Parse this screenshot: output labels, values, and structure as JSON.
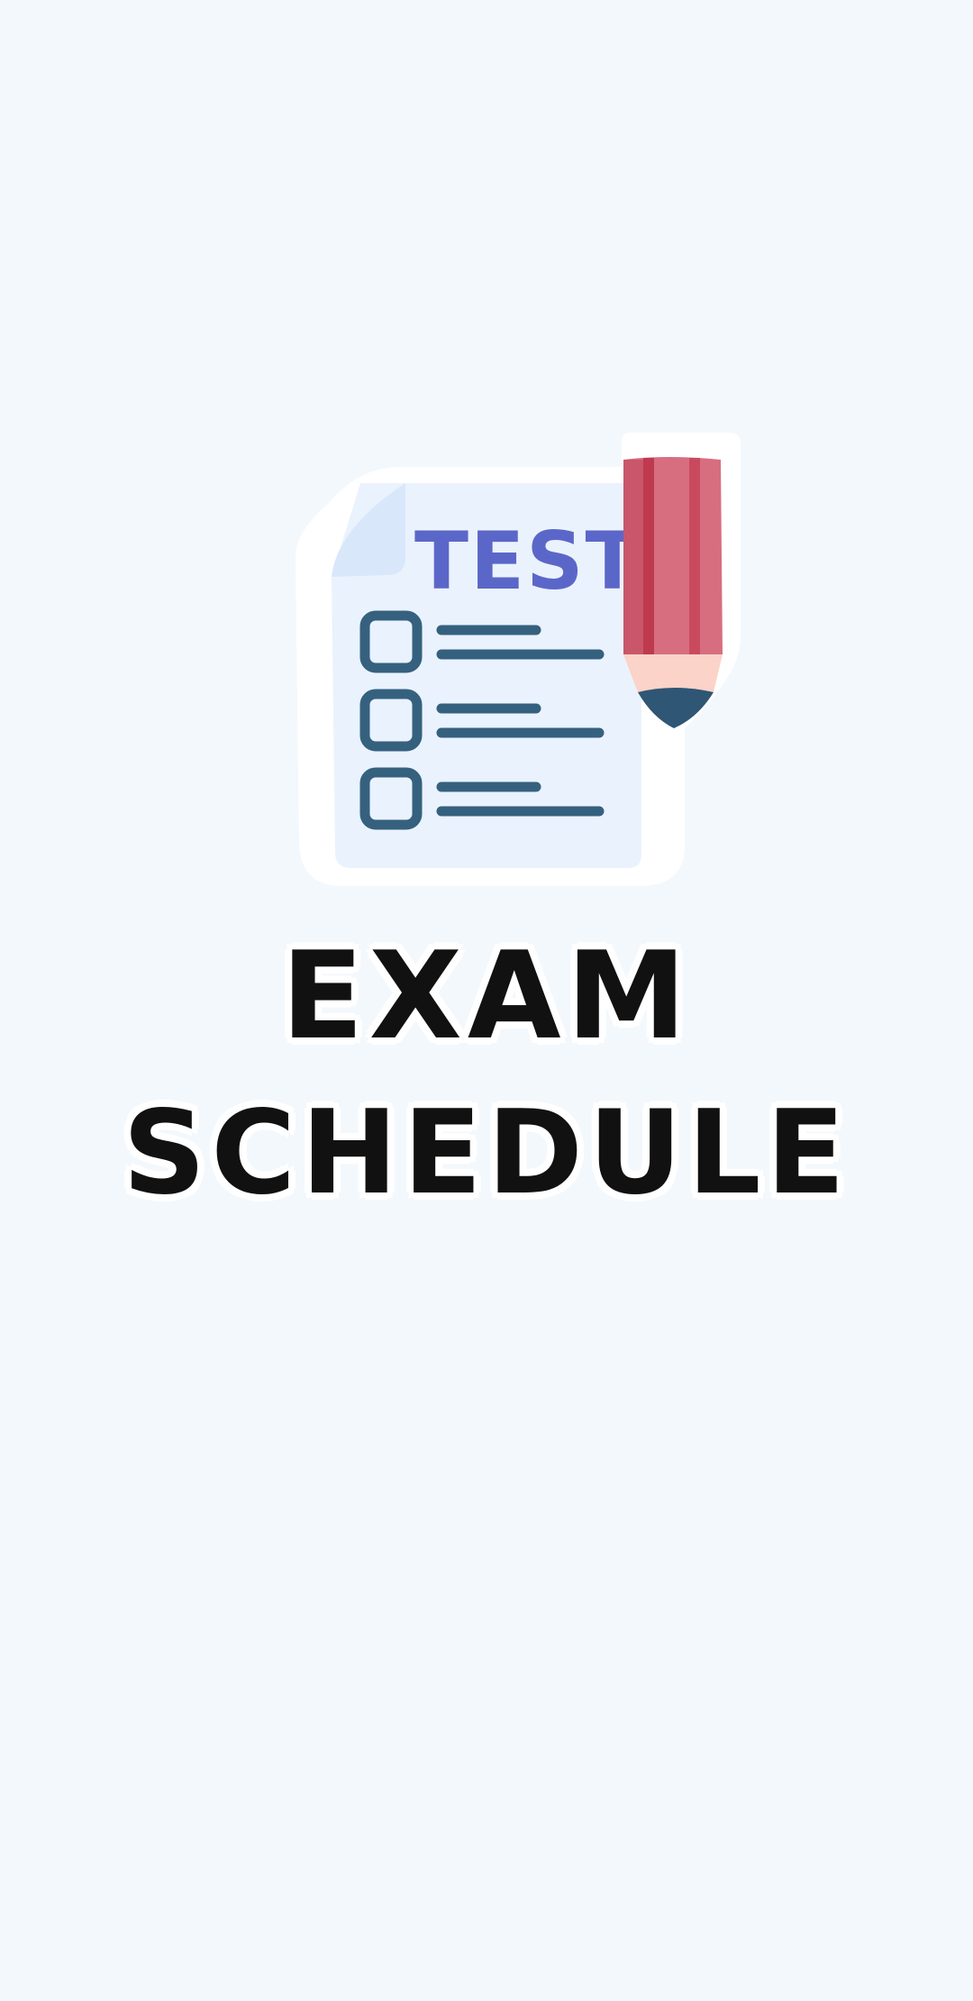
{
  "splash": {
    "logo_badge_text": "TEST",
    "title_line_1": "EXAM",
    "title_line_2": "SCHEDULE"
  },
  "icons": {
    "logo": "test-paper-with-pencil-icon"
  },
  "colors": {
    "background": "#f3f8fd",
    "paper": "#eaf2fd",
    "badge_text": "#5b67c8",
    "checklist": "#35617f",
    "pencil_body": "#c9566b",
    "pencil_tip": "#2f5675",
    "title_text": "#111111"
  }
}
